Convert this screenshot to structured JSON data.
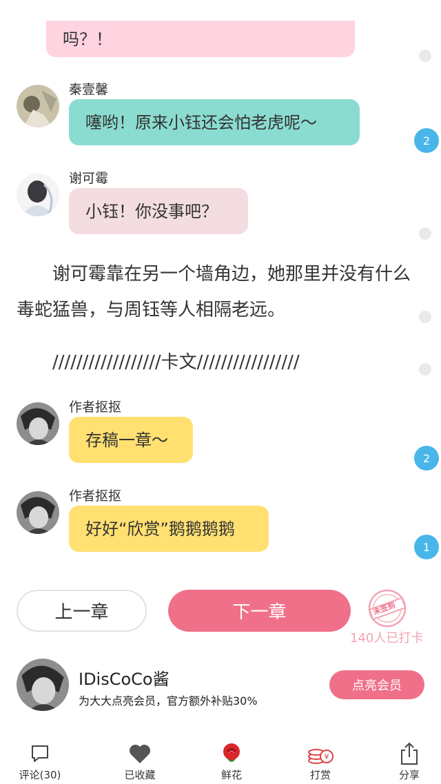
{
  "messages": [
    {
      "text": "吗？！"
    },
    {
      "author": "秦壹馨",
      "text": "噻哟！原来小钰还会怕老虎呢～"
    },
    {
      "author": "谢可霉",
      "text": "小钰！你没事吧？"
    },
    {
      "author": "作者抠抠",
      "text": "存稿一章～"
    },
    {
      "author": "作者抠抠",
      "text": "好好“欣赏”鹅鹅鹅鹅"
    }
  ],
  "paragraphs": [
    "　　谢可霉靠在另一个墙角边，她那里并没有什么毒蛇猛兽，与周钰等人相隔老远。",
    "　　//////////////////卡文/////////////////"
  ],
  "side_counts": [
    "2",
    "2",
    "1"
  ],
  "nav": {
    "prev_label": "上一章",
    "next_label": "下一章",
    "stamp_text": "未签到",
    "checkin_text": "140人已打卡"
  },
  "promo": {
    "username": "IDisCoCo酱",
    "desc": "为大大点亮会员，官方额外补贴30%",
    "button_label": "点亮会员"
  },
  "tabbar": [
    {
      "label": "评论(30)",
      "icon": "comment-icon"
    },
    {
      "label": "已收藏",
      "icon": "heart-icon"
    },
    {
      "label": "鲜花",
      "icon": "rose-icon"
    },
    {
      "label": "打赏",
      "icon": "coins-icon"
    },
    {
      "label": "分享",
      "icon": "share-icon"
    }
  ],
  "colors": {
    "pink_bubble": "#ffd3df",
    "teal_bubble": "#8bdcd0",
    "rose_bubble": "#f3dde0",
    "yellow_bubble": "#ffe071",
    "next_button": "#f07089",
    "badge": "#49b6ea"
  }
}
